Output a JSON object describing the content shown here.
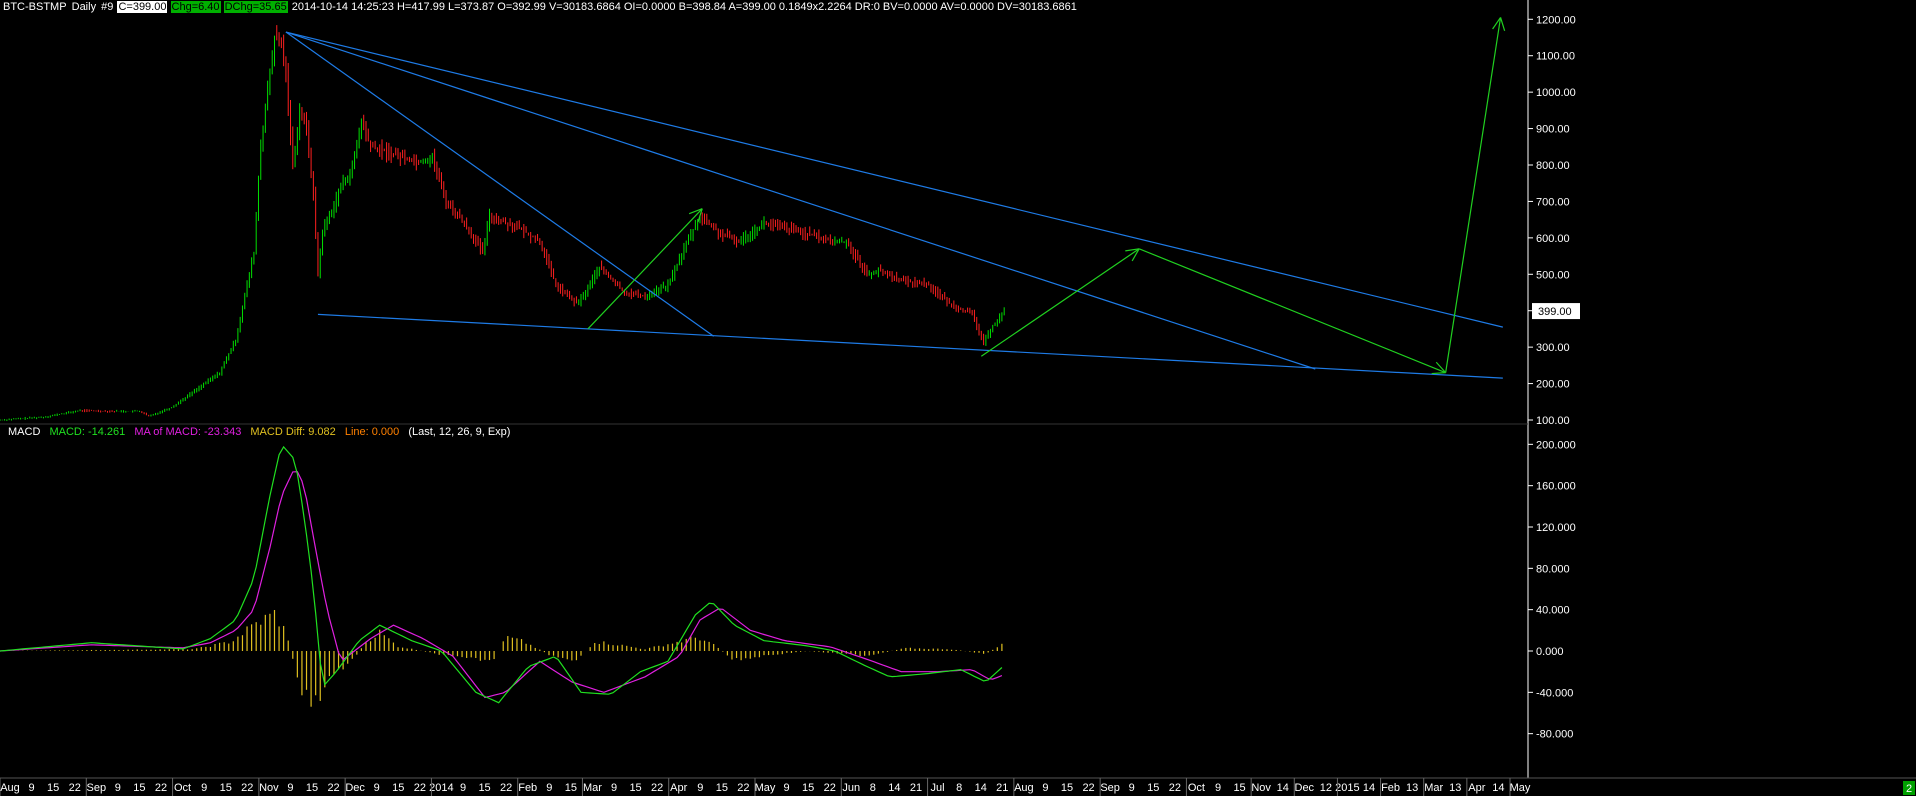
{
  "header": {
    "symbol": "BTC-BSTMP",
    "period": "Daily",
    "num": "#9",
    "close_box": "C=399.00",
    "chg_box": "Chg=6.40",
    "dchg_box": "DChg=35.65",
    "info": "2014-10-14 14:25:23 H=417.99 L=373.87 O=392.99 V=30183.6864 OI=0.0000 B=398.84 A=399.00 0.1849x2.2264 DR:0 BV=0.0000 AV=0.0000 DV=30183.6861"
  },
  "macd_header": {
    "name": "MACD",
    "macd": "MACD: -14.261",
    "ma": "MA of MACD: -23.343",
    "diff": "MACD Diff: 9.082",
    "line": "Line: 0.000",
    "params": "(Last, 12, 26, 9, Exp)"
  },
  "colors": {
    "up": "#00e000",
    "down": "#ff2020",
    "trendline": "#1e7be6",
    "projection": "#20d020",
    "macd_line": "#20e020",
    "signal_line": "#e020e0",
    "histogram": "#e0c020",
    "axis": "#ffffff"
  },
  "price_badge": "399.00",
  "corner_badge": "2",
  "chart_data": [
    {
      "type": "candlestick",
      "title": "BTC-BSTMP Daily",
      "ylim": [
        100,
        1220
      ],
      "y_ticks": [
        "1200.00",
        "1100.00",
        "1000.00",
        "900.00",
        "800.00",
        "700.00",
        "600.00",
        "500.00",
        "400.00",
        "300.00",
        "200.00",
        "100.00"
      ],
      "x_start": "2013-08-01",
      "x_end": "2015-05-31",
      "x_labels": [
        "Aug",
        "9",
        "15",
        "22",
        "Sep",
        "9",
        "15",
        "22",
        "Oct",
        "9",
        "15",
        "22",
        "Nov",
        "9",
        "15",
        "22",
        "Dec",
        "9",
        "15",
        "22",
        "2014",
        "9",
        "15",
        "22",
        "Feb",
        "9",
        "15",
        "Mar",
        "9",
        "15",
        "22",
        "Apr",
        "9",
        "15",
        "22",
        "May",
        "9",
        "15",
        "22",
        "Jun",
        "8",
        "14",
        "21",
        "Jul",
        "8",
        "14",
        "21",
        "Aug",
        "9",
        "15",
        "22",
        "Sep",
        "9",
        "15",
        "22",
        "Oct",
        "9",
        "15",
        "Nov",
        "14",
        "Dec",
        "12",
        "2015",
        "14",
        "Feb",
        "13",
        "Mar",
        "13",
        "Apr",
        "14",
        "May"
      ],
      "price_path": [
        [
          "2013-08-01",
          100
        ],
        [
          "2013-08-20",
          108
        ],
        [
          "2013-09-05",
          126
        ],
        [
          "2013-09-20",
          124
        ],
        [
          "2013-10-01",
          124
        ],
        [
          "2013-10-05",
          110
        ],
        [
          "2013-10-15",
          135
        ],
        [
          "2013-10-25",
          180
        ],
        [
          "2013-11-05",
          230
        ],
        [
          "2013-11-12",
          320
        ],
        [
          "2013-11-18",
          500
        ],
        [
          "2013-11-20",
          560
        ],
        [
          "2013-11-23",
          860
        ],
        [
          "2013-11-26",
          1000
        ],
        [
          "2013-11-29",
          1150
        ],
        [
          "2013-12-02",
          1130
        ],
        [
          "2013-12-04",
          1050
        ],
        [
          "2013-12-07",
          800
        ],
        [
          "2013-12-10",
          950
        ],
        [
          "2013-12-13",
          900
        ],
        [
          "2013-12-16",
          720
        ],
        [
          "2013-12-18",
          500
        ],
        [
          "2013-12-20",
          620
        ],
        [
          "2013-12-23",
          660
        ],
        [
          "2013-12-28",
          740
        ],
        [
          "2014-01-02",
          790
        ],
        [
          "2014-01-06",
          920
        ],
        [
          "2014-01-10",
          850
        ],
        [
          "2014-01-20",
          830
        ],
        [
          "2014-01-31",
          810
        ],
        [
          "2014-02-06",
          820
        ],
        [
          "2014-02-12",
          700
        ],
        [
          "2014-02-20",
          640
        ],
        [
          "2014-02-28",
          560
        ],
        [
          "2014-03-03",
          660
        ],
        [
          "2014-03-15",
          630
        ],
        [
          "2014-03-25",
          590
        ],
        [
          "2014-04-01",
          470
        ],
        [
          "2014-04-10",
          420
        ],
        [
          "2014-04-13",
          440
        ],
        [
          "2014-04-20",
          520
        ],
        [
          "2014-05-01",
          450
        ],
        [
          "2014-05-10",
          440
        ],
        [
          "2014-05-20",
          470
        ],
        [
          "2014-05-27",
          570
        ],
        [
          "2014-06-03",
          660
        ],
        [
          "2014-06-12",
          610
        ],
        [
          "2014-06-20",
          590
        ],
        [
          "2014-07-01",
          640
        ],
        [
          "2014-07-15",
          620
        ],
        [
          "2014-07-31",
          590
        ],
        [
          "2014-08-06",
          590
        ],
        [
          "2014-08-15",
          500
        ],
        [
          "2014-08-20",
          510
        ],
        [
          "2014-09-01",
          480
        ],
        [
          "2014-09-10",
          475
        ],
        [
          "2014-09-20",
          420
        ],
        [
          "2014-09-30",
          390
        ],
        [
          "2014-10-05",
          310
        ],
        [
          "2014-10-08",
          350
        ],
        [
          "2014-10-14",
          399
        ]
      ],
      "trendlines": [
        {
          "from": [
            "2013-12-04",
            1165
          ],
          "to": [
            "2015-05-20",
            355
          ]
        },
        {
          "from": [
            "2013-12-04",
            1165
          ],
          "to": [
            "2015-02-27",
            240
          ]
        },
        {
          "from": [
            "2013-12-04",
            1165
          ],
          "to": [
            "2014-06-09",
            330
          ]
        },
        {
          "from": [
            "2013-12-18",
            390
          ],
          "to": [
            "2015-05-20",
            215
          ]
        }
      ],
      "projections": [
        {
          "from": [
            "2014-04-15",
            350
          ],
          "to": [
            "2014-06-04",
            680
          ]
        },
        {
          "from": [
            "2014-10-04",
            275
          ],
          "to": [
            "2014-12-12",
            570
          ]
        },
        {
          "from": [
            "2014-12-12",
            570
          ],
          "to": [
            "2015-04-25",
            230
          ]
        },
        {
          "from": [
            "2015-04-25",
            230
          ],
          "to": [
            "2015-05-19",
            1205
          ]
        }
      ]
    },
    {
      "type": "macd",
      "ylim": [
        -120,
        210
      ],
      "y_ticks": [
        "200.000",
        "160.000",
        "120.000",
        "80.000",
        "40.000",
        "0.000",
        "-40.000",
        "-80.000"
      ],
      "macd": [
        [
          "2013-08-01",
          0
        ],
        [
          "2013-09-10",
          8
        ],
        [
          "2013-10-20",
          2
        ],
        [
          "2013-11-01",
          12
        ],
        [
          "2013-11-12",
          30
        ],
        [
          "2013-11-20",
          70
        ],
        [
          "2013-11-27",
          150
        ],
        [
          "2013-12-02",
          200
        ],
        [
          "2013-12-08",
          185
        ],
        [
          "2013-12-12",
          130
        ],
        [
          "2013-12-16",
          60
        ],
        [
          "2013-12-20",
          -35
        ],
        [
          "2013-12-26",
          -20
        ],
        [
          "2014-01-05",
          10
        ],
        [
          "2014-01-14",
          25
        ],
        [
          "2014-01-28",
          10
        ],
        [
          "2014-02-10",
          0
        ],
        [
          "2014-02-25",
          -40
        ],
        [
          "2014-03-07",
          -50
        ],
        [
          "2014-03-20",
          -15
        ],
        [
          "2014-04-01",
          -5
        ],
        [
          "2014-04-12",
          -40
        ],
        [
          "2014-04-25",
          -42
        ],
        [
          "2014-05-08",
          -20
        ],
        [
          "2014-05-20",
          -10
        ],
        [
          "2014-06-01",
          35
        ],
        [
          "2014-06-08",
          48
        ],
        [
          "2014-06-18",
          25
        ],
        [
          "2014-07-01",
          10
        ],
        [
          "2014-07-20",
          5
        ],
        [
          "2014-08-01",
          0
        ],
        [
          "2014-08-15",
          -15
        ],
        [
          "2014-08-25",
          -25
        ],
        [
          "2014-09-10",
          -22
        ],
        [
          "2014-09-25",
          -18
        ],
        [
          "2014-10-06",
          -30
        ],
        [
          "2014-10-14",
          -14
        ]
      ],
      "signal": [
        [
          "2013-08-01",
          0
        ],
        [
          "2013-09-10",
          6
        ],
        [
          "2013-10-20",
          3
        ],
        [
          "2013-11-01",
          8
        ],
        [
          "2013-11-12",
          20
        ],
        [
          "2013-11-20",
          40
        ],
        [
          "2013-11-27",
          100
        ],
        [
          "2013-12-02",
          150
        ],
        [
          "2013-12-08",
          178
        ],
        [
          "2013-12-12",
          160
        ],
        [
          "2013-12-16",
          110
        ],
        [
          "2013-12-22",
          40
        ],
        [
          "2013-12-28",
          -10
        ],
        [
          "2014-01-10",
          12
        ],
        [
          "2014-01-20",
          25
        ],
        [
          "2014-02-02",
          12
        ],
        [
          "2014-02-15",
          -5
        ],
        [
          "2014-03-01",
          -45
        ],
        [
          "2014-03-10",
          -40
        ],
        [
          "2014-03-25",
          -10
        ],
        [
          "2014-04-08",
          -30
        ],
        [
          "2014-04-22",
          -40
        ],
        [
          "2014-05-10",
          -25
        ],
        [
          "2014-05-25",
          -5
        ],
        [
          "2014-06-03",
          30
        ],
        [
          "2014-06-12",
          42
        ],
        [
          "2014-06-25",
          20
        ],
        [
          "2014-07-10",
          10
        ],
        [
          "2014-07-30",
          4
        ],
        [
          "2014-08-15",
          -8
        ],
        [
          "2014-08-30",
          -20
        ],
        [
          "2014-09-15",
          -20
        ],
        [
          "2014-09-30",
          -18
        ],
        [
          "2014-10-08",
          -28
        ],
        [
          "2014-10-14",
          -23
        ]
      ],
      "histogram": [
        [
          "2013-08-01",
          0
        ],
        [
          "2013-10-25",
          2
        ],
        [
          "2013-11-10",
          10
        ],
        [
          "2013-11-20",
          28
        ],
        [
          "2013-11-29",
          40
        ],
        [
          "2013-12-04",
          20
        ],
        [
          "2013-12-10",
          -40
        ],
        [
          "2013-12-17",
          -55
        ],
        [
          "2013-12-22",
          -30
        ],
        [
          "2014-01-02",
          -10
        ],
        [
          "2014-01-08",
          10
        ],
        [
          "2014-01-14",
          20
        ],
        [
          "2014-01-22",
          5
        ],
        [
          "2014-02-08",
          -3
        ],
        [
          "2014-02-20",
          -8
        ],
        [
          "2014-03-05",
          -10
        ],
        [
          "2014-03-10",
          15
        ],
        [
          "2014-03-18",
          10
        ],
        [
          "2014-03-30",
          -5
        ],
        [
          "2014-04-10",
          -10
        ],
        [
          "2014-04-18",
          10
        ],
        [
          "2014-04-25",
          8
        ],
        [
          "2014-05-10",
          2
        ],
        [
          "2014-05-25",
          10
        ],
        [
          "2014-06-02",
          15
        ],
        [
          "2014-06-10",
          5
        ],
        [
          "2014-06-18",
          -10
        ],
        [
          "2014-07-01",
          -5
        ],
        [
          "2014-07-20",
          0
        ],
        [
          "2014-08-15",
          -5
        ],
        [
          "2014-09-01",
          3
        ],
        [
          "2014-09-20",
          2
        ],
        [
          "2014-10-06",
          -3
        ],
        [
          "2014-10-14",
          9
        ]
      ]
    }
  ]
}
